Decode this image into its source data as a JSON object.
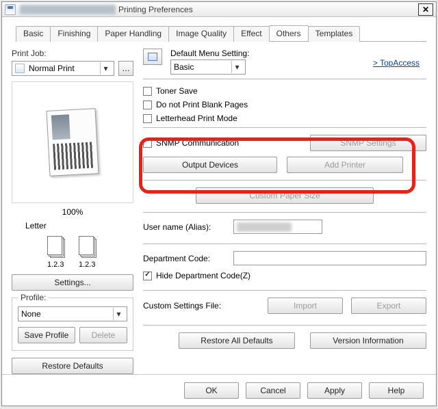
{
  "window": {
    "title_suffix": "Printing Preferences"
  },
  "tabs": [
    "Basic",
    "Finishing",
    "Paper Handling",
    "Image Quality",
    "Effect",
    "Others",
    "Templates"
  ],
  "active_tab": "Others",
  "left": {
    "print_job_label": "Print Job:",
    "print_job_value": "Normal Print",
    "zoom": "100%",
    "paper": "Letter",
    "mini_label_a": "1.2.3",
    "mini_label_b": "1.2.3",
    "settings_btn": "Settings...",
    "profile_label": "Profile:",
    "profile_value": "None",
    "save_profile": "Save Profile",
    "delete_profile": "Delete",
    "restore_defaults": "Restore Defaults"
  },
  "right": {
    "default_menu_label": "Default Menu Setting:",
    "default_menu_value": "Basic",
    "topaccess": ">  TopAccess",
    "cb_toner": "Toner Save",
    "cb_blank": "Do not Print Blank Pages",
    "cb_letterhead": "Letterhead Print Mode",
    "cb_snmp": "SNMP Communication",
    "snmp_settings": "SNMP Settings",
    "output_devices": "Output Devices",
    "add_printer": "Add Printer",
    "custom_paper": "Custom Paper Size",
    "user_name_label": "User name (Alias):",
    "dept_code_label": "Department Code:",
    "cb_hide_dept": "Hide Department Code(Z)",
    "custom_settings_label": "Custom Settings File:",
    "import": "Import",
    "export": "Export",
    "restore_all": "Restore All Defaults",
    "version_info": "Version Information"
  },
  "buttons": {
    "ok": "OK",
    "cancel": "Cancel",
    "apply": "Apply",
    "help": "Help"
  }
}
